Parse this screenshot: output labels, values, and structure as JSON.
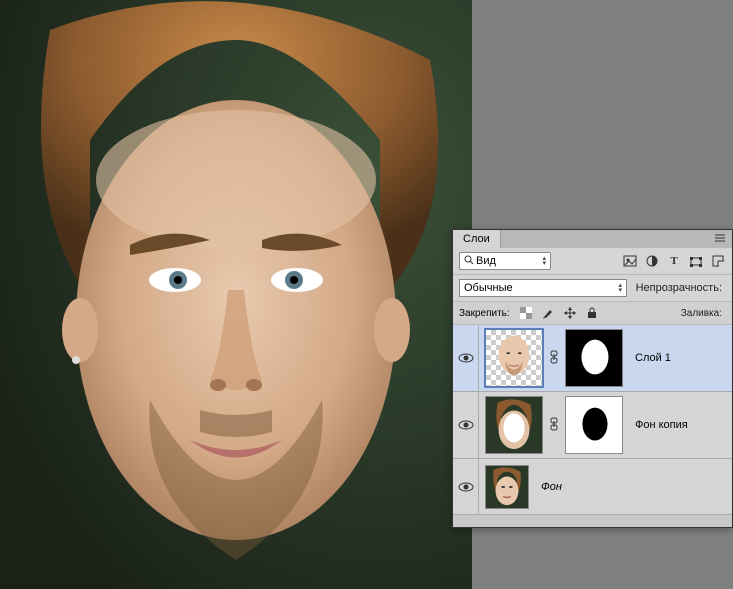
{
  "panel": {
    "tab_label": "Слои",
    "search_placeholder": "Вид",
    "blend_mode": "Обычные",
    "opacity_label": "Непрозрачность:",
    "lock_label": "Закрепить:",
    "fill_label": "Заливка:"
  },
  "layers": [
    {
      "name": "Слой 1",
      "has_mask": true,
      "mask_invert": false,
      "selected": true
    },
    {
      "name": "Фон копия",
      "has_mask": true,
      "mask_invert": true,
      "selected": false
    },
    {
      "name": "Фон",
      "has_mask": false,
      "selected": false
    }
  ],
  "icons": {
    "filter_image": "img",
    "filter_adjust": "adj",
    "filter_text": "T",
    "filter_shape": "shape",
    "filter_smart": "smart"
  }
}
